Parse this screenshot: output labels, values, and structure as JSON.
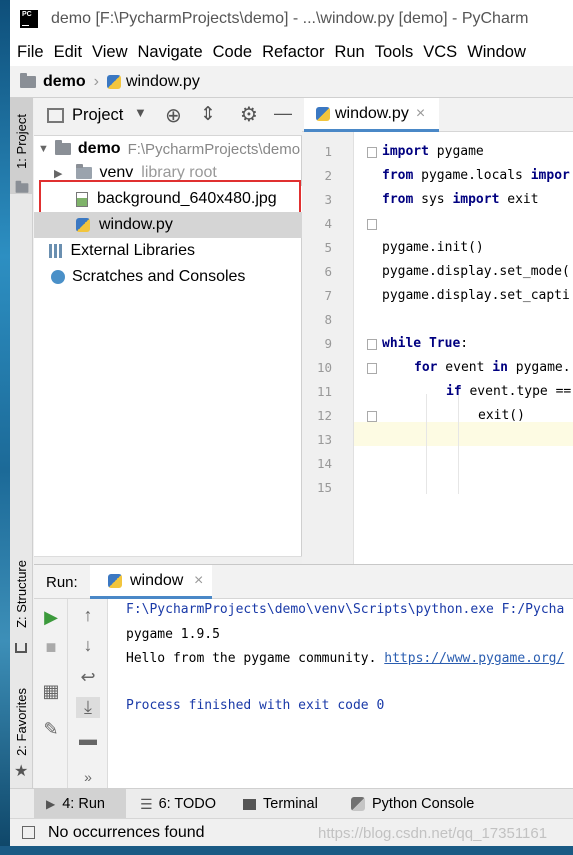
{
  "window": {
    "title": "demo [F:\\PycharmProjects\\demo] - ...\\window.py [demo] - PyCharm",
    "app_icon_text": "PC"
  },
  "menu": {
    "items": [
      "File",
      "Edit",
      "View",
      "Navigate",
      "Code",
      "Refactor",
      "Run",
      "Tools",
      "VCS",
      "Window"
    ]
  },
  "navbar": {
    "project": "demo",
    "file": "window.py"
  },
  "left_strip": {
    "project_tab": "1: Project",
    "structure_tab": "Z: Structure",
    "favorites_tab": "2: Favorites"
  },
  "project_panel": {
    "header_label": "Project",
    "root_name": "demo",
    "root_path": "F:\\PycharmProjects\\demo",
    "venv_name": "venv",
    "venv_note": "library root",
    "highlighted_file": "background_640x480.jpg",
    "window_file": "window.py",
    "external_libraries": "External Libraries",
    "scratches": "Scratches and Consoles",
    "highlight_color": "#e03030"
  },
  "editor": {
    "tab_label": "window.py",
    "line_numbers": [
      "1",
      "2",
      "3",
      "4",
      "5",
      "6",
      "7",
      "8",
      "9",
      "10",
      "11",
      "12",
      "13",
      "14",
      "15"
    ],
    "lines": [
      {
        "kw": "import",
        "rest": " pygame"
      },
      {
        "kw": "from",
        "rest": " pygame.locals ",
        "kw2": "impor"
      },
      {
        "kw": "from",
        "rest": " sys ",
        "kw2": "import",
        "rest2": " exit"
      },
      {
        "kw": "",
        "rest": ""
      },
      {
        "kw": "",
        "rest": "pygame.init()"
      },
      {
        "kw": "",
        "rest": "pygame.display.set_mode("
      },
      {
        "kw": "",
        "rest": "pygame.display.set_capti"
      },
      {
        "kw": "",
        "rest": ""
      },
      {
        "kw": "while",
        "rest": " ",
        "kw2": "True",
        ":": ":"
      },
      {
        "kw": "for",
        "rest": " event ",
        "kw2": "in",
        "rest2": " pygame."
      },
      {
        "kw": "if",
        "rest": " event.type =="
      },
      {
        "kw": "",
        "rest": "exit()"
      }
    ],
    "colon": ":"
  },
  "run_panel": {
    "label": "Run:",
    "tab_label": "window",
    "output": {
      "command": "F:\\PycharmProjects\\demo\\venv\\Scripts\\python.exe F:/Pycha",
      "version": "pygame 1.9.5",
      "hello": "Hello from the pygame community. ",
      "link": "https://www.pygame.org/",
      "finished": "Process finished with exit code 0"
    },
    "overflow_glyph": "»"
  },
  "bottom_tabs": {
    "run": "4: Run",
    "todo": "6: TODO",
    "terminal": "Terminal",
    "python_console": "Python Console"
  },
  "status": {
    "text": "No occurrences found",
    "watermark": "https://blog.csdn.net/qq_17351161"
  },
  "colors": {
    "keyword": "#000080",
    "accent": "#4a88c7",
    "link": "#2a5db0",
    "output_blue": "#1a3aa8"
  }
}
